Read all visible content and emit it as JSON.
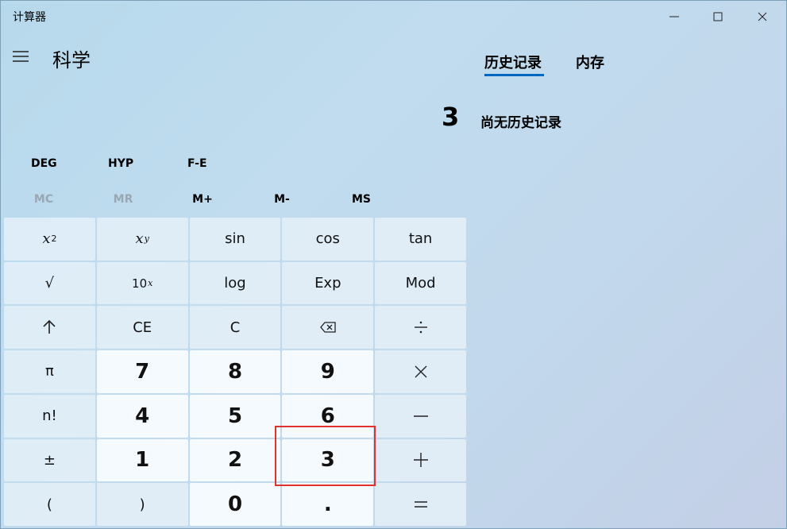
{
  "window": {
    "title": "计算器"
  },
  "header": {
    "mode_title": "科学"
  },
  "tabs": {
    "history": "历史记录",
    "memory": "内存"
  },
  "display": {
    "value": "3"
  },
  "history_panel": {
    "empty_text": "尚无历史记录"
  },
  "modes": {
    "angle": "DEG",
    "hyp": "HYP",
    "fe": "F-E"
  },
  "memory": {
    "mc": "MC",
    "mr": "MR",
    "mplus": "M+",
    "mminus": "M-",
    "ms": "MS"
  },
  "keys": {
    "x": "x",
    "sq_exp": "2",
    "y": "y",
    "sin": "sin",
    "cos": "cos",
    "tan": "tan",
    "sqrt": "√",
    "ten": "10",
    "ten_exp": "x",
    "log": "log",
    "exp": "Exp",
    "mod": "Mod",
    "ce": "CE",
    "c": "C",
    "pi": "π",
    "fact": "n!",
    "plusminus": "±",
    "lparen": "(",
    "rparen": ")",
    "decimal": ".",
    "d0": "0",
    "d1": "1",
    "d2": "2",
    "d3": "3",
    "d4": "4",
    "d5": "5",
    "d6": "6",
    "d7": "7",
    "d8": "8",
    "d9": "9"
  }
}
